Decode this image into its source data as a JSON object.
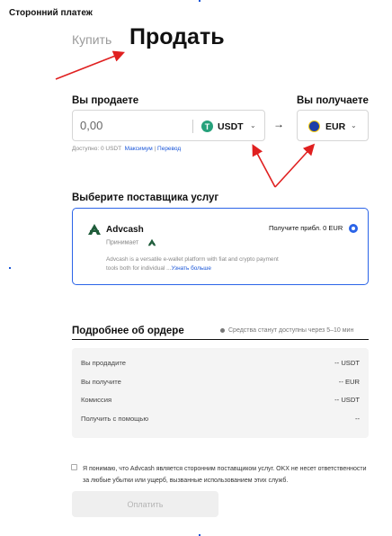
{
  "header": {
    "title": "Сторонний платеж"
  },
  "tabs": {
    "buy": "Купить",
    "sell": "Продать"
  },
  "sell": {
    "label": "Вы продаете",
    "amount_placeholder": "0,00",
    "currency": "USDT",
    "available": "Доступно: 0 USDT",
    "max_link": "Максимум",
    "sep": "|",
    "transfer_link": "Перевод"
  },
  "receive": {
    "label": "Вы получаете",
    "currency": "EUR"
  },
  "arrow": "→",
  "provider_section": {
    "title": "Выберите поставщика услуг"
  },
  "provider": {
    "name": "Advcash",
    "accepts": "Принимает",
    "rate": "Получите прибл. 0 EUR",
    "description": "Advcash is a versatile e-wallet platform with fiat and crypto payment tools both for individual ...",
    "more_link": "Узнать больше"
  },
  "order": {
    "title": "Подробнее об ордере",
    "note": "Средства станут доступны через 5–10 мин",
    "rows": [
      {
        "key": "Вы продадите",
        "value": "-- USDT"
      },
      {
        "key": "Вы получите",
        "value": "-- EUR"
      },
      {
        "key": "Комиссия",
        "value": "-- USDT"
      },
      {
        "key": "Получить с помощью",
        "value": "--"
      }
    ]
  },
  "disclaimer": "Я понимаю, что Advcash является сторонним поставщиком услуг. OKX не несет ответственности за любые убытки или ущерб, вызванные использованием этих служб.",
  "pay_button": "Оплатить",
  "colors": {
    "accent": "#2b64e8",
    "usdt": "#26a17b",
    "eur": "#1f3fa8",
    "annotation": "#e02020"
  },
  "icons": {
    "usdt": "tether-icon",
    "eur": "euro-flag-icon",
    "provider": "advcash-logo-icon"
  }
}
